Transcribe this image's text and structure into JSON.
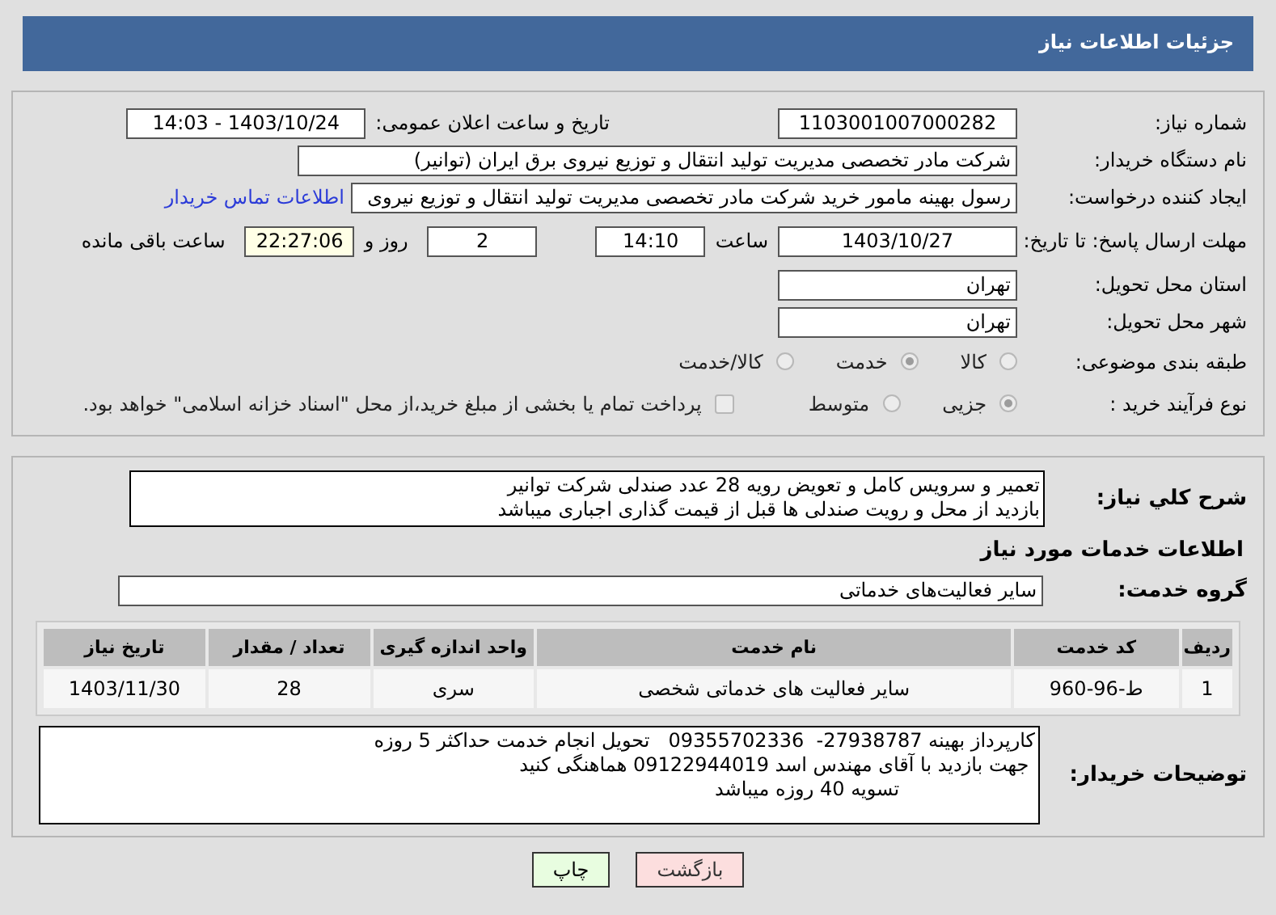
{
  "header": {
    "title": "جزئیات اطلاعات نیاز"
  },
  "need_number": {
    "label": "شماره نیاز:",
    "value": "1103001007000282"
  },
  "announce": {
    "label": "تاریخ و ساعت اعلان عمومی:",
    "value": "1403/10/24 - 14:03"
  },
  "buyer": {
    "label": "نام دستگاه خریدار:",
    "value": "شرکت مادر تخصصی مدیریت تولید  انتقال و توزیع نیروی برق ایران (توانیر)"
  },
  "requester": {
    "label": "ایجاد کننده درخواست:",
    "value": "رسول بهینه مامور خرید شرکت مادر تخصصی مدیریت تولید  انتقال و توزیع نیروی",
    "link": "اطلاعات تماس خریدار"
  },
  "deadline": {
    "label": "مهلت ارسال پاسخ: تا تاریخ:",
    "date": "1403/10/27",
    "time_label": "ساعت",
    "time": "14:10",
    "days": "2",
    "days_label": "روز و",
    "remaining": "22:27:06",
    "remaining_label": "ساعت باقی مانده"
  },
  "province": {
    "label": "استان محل تحویل:",
    "value": "تهران"
  },
  "city": {
    "label": "شهر محل تحویل:",
    "value": "تهران"
  },
  "category": {
    "label": "طبقه بندی موضوعی:",
    "options": [
      {
        "label": "کالا",
        "selected": false
      },
      {
        "label": "خدمت",
        "selected": true
      },
      {
        "label": "کالا/خدمت",
        "selected": false
      }
    ]
  },
  "process": {
    "label": "نوع فرآیند خرید :",
    "options": [
      {
        "label": "جزیی",
        "selected": true
      },
      {
        "label": "متوسط",
        "selected": false
      }
    ],
    "payment": {
      "checked": false,
      "text": "پرداخت تمام یا بخشی از مبلغ خرید،از محل \"اسناد خزانه اسلامی\" خواهد بود."
    }
  },
  "description": {
    "label": "شرح کلي نياز:",
    "lines": [
      "تعمیر و سرویس کامل و تعویض رویه 28 عدد صندلی شرکت توانیر",
      "بازدید از محل و رویت صندلی ها قبل از قیمت گذاری اجباری میباشد"
    ]
  },
  "services_title": "اطلاعات خدمات مورد نیاز",
  "service_group": {
    "label": "گروه خدمت:",
    "value": "سایر فعالیت‌های خدماتی"
  },
  "table": {
    "columns": [
      "ردیف",
      "کد خدمت",
      "نام خدمت",
      "واحد اندازه گیری",
      "تعداد / مقدار",
      "تاریخ نیاز"
    ],
    "rows": [
      [
        "1",
        "ط-96-960",
        "سایر فعالیت های خدماتی شخصی",
        "سری",
        "28",
        "1403/11/30"
      ]
    ]
  },
  "buyer_notes": {
    "label": "توضیحات خریدار:",
    "lines": [
      "کارپرداز بهینه 27938787-  09355702336   تحویل انجام خدمت حداکثر 5 روزه",
      " جهت بازدید با آقای مهندس اسد 09122944019 هماهنگی کنید",
      "                      تسویه 40 روزه میباشد"
    ]
  },
  "buttons": [
    {
      "label": "بازگشت",
      "kind": "back"
    },
    {
      "label": "چاپ",
      "kind": "print"
    }
  ]
}
